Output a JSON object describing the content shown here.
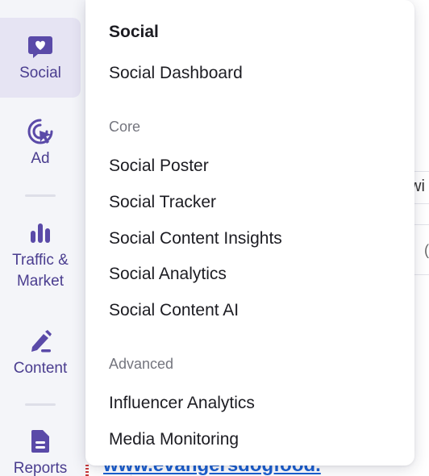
{
  "rail": {
    "items": [
      {
        "label": "Social",
        "icon": "heart-chat-icon"
      },
      {
        "label": "Ad",
        "icon": "target-cursor-icon"
      },
      {
        "label_line1": "Traffic &",
        "label_line2": "Market",
        "icon": "bar-chart-icon"
      },
      {
        "label": "Content",
        "icon": "pencil-icon"
      },
      {
        "label": "Reports",
        "icon": "document-icon"
      }
    ],
    "accent_color": "#4a3d8f",
    "active_bg": "#e6e4f3"
  },
  "menu": {
    "title": "Social",
    "top_items": [
      "Social Dashboard"
    ],
    "sections": [
      {
        "heading": "Core",
        "items": [
          "Social Poster",
          "Social Tracker",
          "Social Content Insights",
          "Social Analytics",
          "Social Content AI"
        ]
      },
      {
        "heading": "Advanced",
        "items": [
          "Influencer Analytics",
          "Media Monitoring"
        ]
      }
    ]
  },
  "background": {
    "fragment_right": "wi",
    "fragment_small": "(",
    "url_text": "www.evangersdogfood."
  }
}
